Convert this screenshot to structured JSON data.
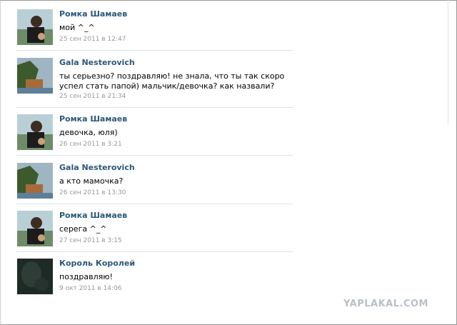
{
  "posts": [
    {
      "author": "Ромка Шамаев",
      "text": "мой ^_^",
      "date": "25 сен 2011 в 12:47",
      "avatar": "avatar-roma"
    },
    {
      "author": "Gala Nesterovich",
      "text": "ты серьезно? поздравляю! не знала, что ты так скоро успел стать папой) мальчик/девочка? как назвали?",
      "date": "25 сен 2011 в 21:34",
      "avatar": "avatar-gala"
    },
    {
      "author": "Ромка Шамаев",
      "text": "девочка, юля)",
      "date": "26 сен 2011 в 3:21",
      "avatar": "avatar-roma"
    },
    {
      "author": "Gala Nesterovich",
      "text": "а кто мамочка?",
      "date": "26 сен 2011 в 13:30",
      "avatar": "avatar-gala"
    },
    {
      "author": "Ромка Шамаев",
      "text": "серега ^_^",
      "date": "27 сен 2011 в 3:15",
      "avatar": "avatar-roma"
    },
    {
      "author": "Король Королей",
      "text": "поздравляю!",
      "date": "9 окт 2011 в 14:06",
      "avatar": "avatar-dark"
    }
  ],
  "watermark": "YAPLAKAL.COM",
  "colors": {
    "author": "#2b587a",
    "date": "#999999",
    "divider": "#dae1e8"
  }
}
